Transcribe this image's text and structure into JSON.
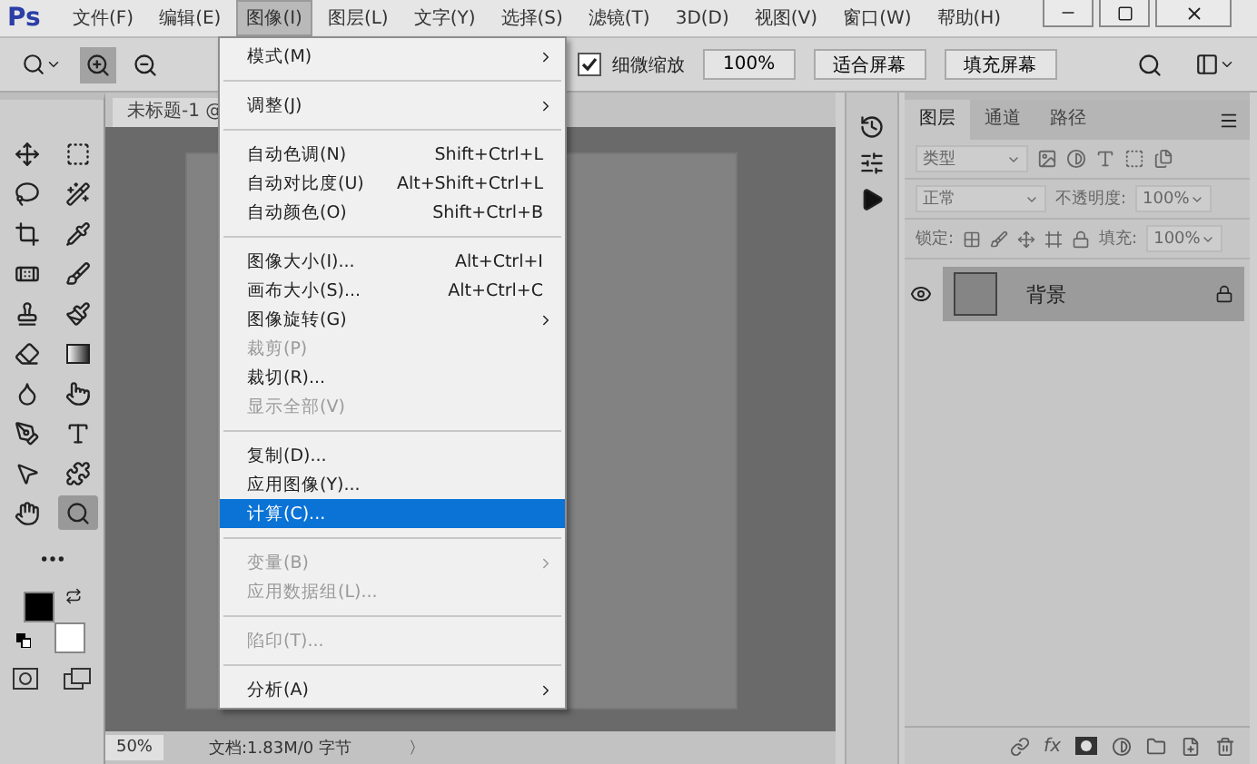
{
  "app": {
    "logo": "Ps"
  },
  "menu_bar": [
    {
      "label": "文件(F)",
      "selected": false
    },
    {
      "label": "编辑(E)",
      "selected": false
    },
    {
      "label": "图像(I)",
      "selected": true
    },
    {
      "label": "图层(L)",
      "selected": false
    },
    {
      "label": "文字(Y)",
      "selected": false
    },
    {
      "label": "选择(S)",
      "selected": false
    },
    {
      "label": "滤镜(T)",
      "selected": false
    },
    {
      "label": "3D(D)",
      "selected": false
    },
    {
      "label": "视图(V)",
      "selected": false
    },
    {
      "label": "窗口(W)",
      "selected": false
    },
    {
      "label": "帮助(H)",
      "selected": false
    }
  ],
  "options_bar": {
    "zoom_in_selected": true,
    "scrubby_zoom": {
      "label": "细微缩放",
      "checked": true
    },
    "buttons": [
      "100%",
      "适合屏幕",
      "填充屏幕"
    ]
  },
  "tools": [
    {
      "selected": false
    },
    {
      "selected": false
    },
    {
      "selected": false
    },
    {
      "selected": false
    },
    {
      "selected": false
    },
    {
      "selected": false
    },
    {
      "selected": false
    },
    {
      "selected": false
    },
    {
      "selected": false
    },
    {
      "selected": false
    },
    {
      "selected": false
    },
    {
      "selected": false
    },
    {
      "selected": false
    },
    {
      "selected": false
    },
    {
      "selected": false
    },
    {
      "selected": false
    },
    {
      "selected": false
    },
    {
      "selected": false
    },
    {
      "selected": false
    },
    {
      "selected": true
    }
  ],
  "document": {
    "tab": "未标题-1 @",
    "zoom": "50%",
    "info": "文档:1.83M/0 字节",
    "arrow": "〉"
  },
  "image_menu": [
    {
      "kind": "item",
      "label": "模式(M)",
      "submenu": true,
      "disabled": false,
      "selected": false
    },
    {
      "kind": "separator"
    },
    {
      "kind": "item",
      "label": "调整(J)",
      "submenu": true,
      "disabled": false,
      "selected": false
    },
    {
      "kind": "separator"
    },
    {
      "kind": "item",
      "label": "自动色调(N)",
      "shortcut": "Shift+Ctrl+L",
      "disabled": false,
      "selected": false
    },
    {
      "kind": "item",
      "label": "自动对比度(U)",
      "shortcut": "Alt+Shift+Ctrl+L",
      "disabled": false,
      "selected": false
    },
    {
      "kind": "item",
      "label": "自动颜色(O)",
      "shortcut": "Shift+Ctrl+B",
      "disabled": false,
      "selected": false
    },
    {
      "kind": "separator"
    },
    {
      "kind": "item",
      "label": "图像大小(I)...",
      "shortcut": "Alt+Ctrl+I",
      "disabled": false,
      "selected": false
    },
    {
      "kind": "item",
      "label": "画布大小(S)...",
      "shortcut": "Alt+Ctrl+C",
      "disabled": false,
      "selected": false
    },
    {
      "kind": "item",
      "label": "图像旋转(G)",
      "submenu": true,
      "disabled": false,
      "selected": false
    },
    {
      "kind": "item",
      "label": "裁剪(P)",
      "disabled": true,
      "selected": false
    },
    {
      "kind": "item",
      "label": "裁切(R)...",
      "disabled": false,
      "selected": false
    },
    {
      "kind": "item",
      "label": "显示全部(V)",
      "disabled": true,
      "selected": false
    },
    {
      "kind": "separator"
    },
    {
      "kind": "item",
      "label": "复制(D)...",
      "disabled": false,
      "selected": false
    },
    {
      "kind": "item",
      "label": "应用图像(Y)...",
      "disabled": false,
      "selected": false
    },
    {
      "kind": "item",
      "label": "计算(C)...",
      "disabled": false,
      "selected": true
    },
    {
      "kind": "separator"
    },
    {
      "kind": "item",
      "label": "变量(B)",
      "submenu": true,
      "disabled": true,
      "selected": false
    },
    {
      "kind": "item",
      "label": "应用数据组(L)...",
      "disabled": true,
      "selected": false
    },
    {
      "kind": "separator"
    },
    {
      "kind": "item",
      "label": "陷印(T)...",
      "disabled": true,
      "selected": false
    },
    {
      "kind": "separator"
    },
    {
      "kind": "item",
      "label": "分析(A)",
      "submenu": true,
      "disabled": false,
      "selected": false
    }
  ],
  "layers_panel": {
    "tabs": [
      {
        "label": "图层",
        "selected": true
      },
      {
        "label": "通道",
        "selected": false
      },
      {
        "label": "路径",
        "selected": false
      }
    ],
    "filter": "类型",
    "blend_mode": "正常",
    "opacity_label": "不透明度:",
    "opacity": "100%",
    "lock_label": "锁定:",
    "fill_label": "填充:",
    "fill": "100%",
    "layers": [
      {
        "name": "背景",
        "visible": true,
        "locked": true
      }
    ],
    "fx": "fx"
  }
}
